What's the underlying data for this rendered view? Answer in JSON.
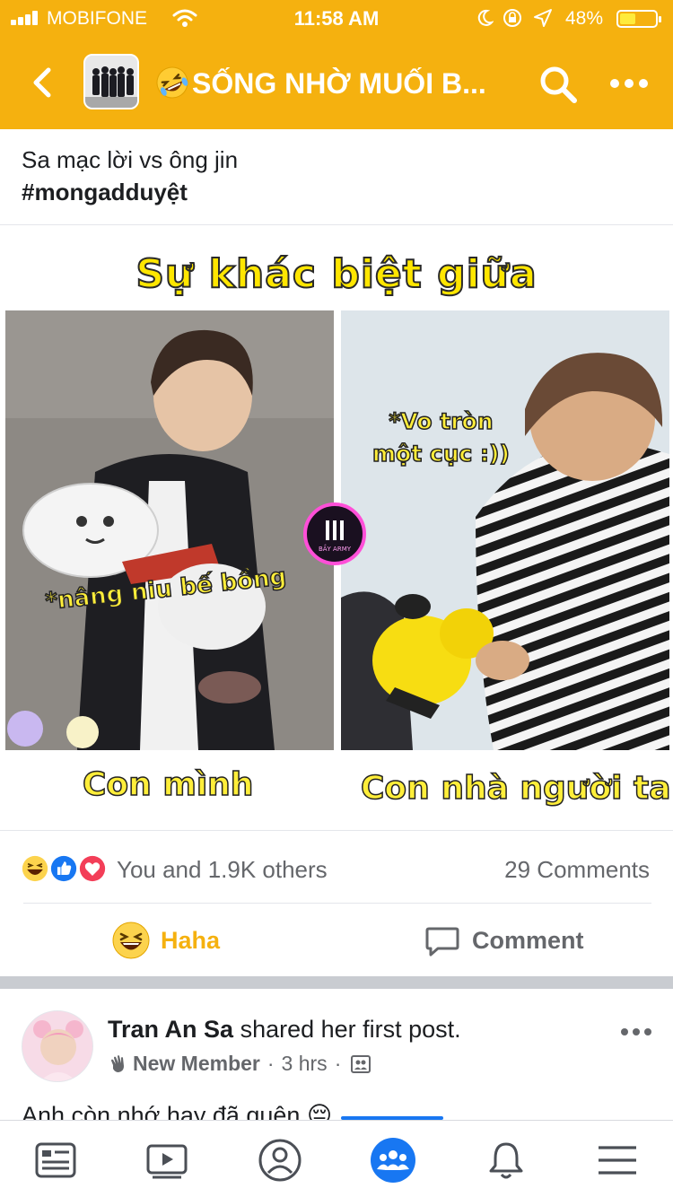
{
  "status_bar": {
    "carrier": "MOBIFONE",
    "time": "11:58 AM",
    "battery": "48%",
    "battery_level": 0.48
  },
  "nav_bar": {
    "title": "SỐNG NHỜ MUỐI B...",
    "icons": [
      "back-arrow-icon",
      "group-avatar",
      "rofl-emoji-icon",
      "search-icon",
      "more-icon"
    ]
  },
  "post": {
    "text_line": "Sa mạc lời vs ông jin",
    "hashtag": "#mongadduyệt",
    "image": {
      "headline": "Sự khác biệt giữa",
      "left_caption": "*nâng niu bế bồng",
      "right_caption_1": "*Vo tròn",
      "right_caption_2": "một cục :))",
      "left_label": "Con mình",
      "right_label": "Con nhà người ta",
      "badge_text": "BẦY ARMY"
    },
    "reactions_text": "You and 1.9K others",
    "comments_text": "29 Comments",
    "reaction_icons": [
      "haha-icon",
      "like-icon",
      "love-icon"
    ],
    "actions": {
      "haha": "Haha",
      "comment": "Comment"
    },
    "colors": {
      "accent": "#f5b10f",
      "brand_blue": "#1877f2"
    }
  },
  "next_post": {
    "author": "Tran An Sa",
    "action": "shared her first post.",
    "role": "New Member",
    "time": "3 hrs",
    "separator": "·",
    "preview": "Anh còn nhớ hay đã quên 😔"
  },
  "tab_bar": {
    "tabs": [
      "news-feed-icon",
      "watch-icon",
      "profile-icon",
      "groups-icon",
      "notifications-icon",
      "menu-icon"
    ],
    "active": "groups-icon"
  }
}
